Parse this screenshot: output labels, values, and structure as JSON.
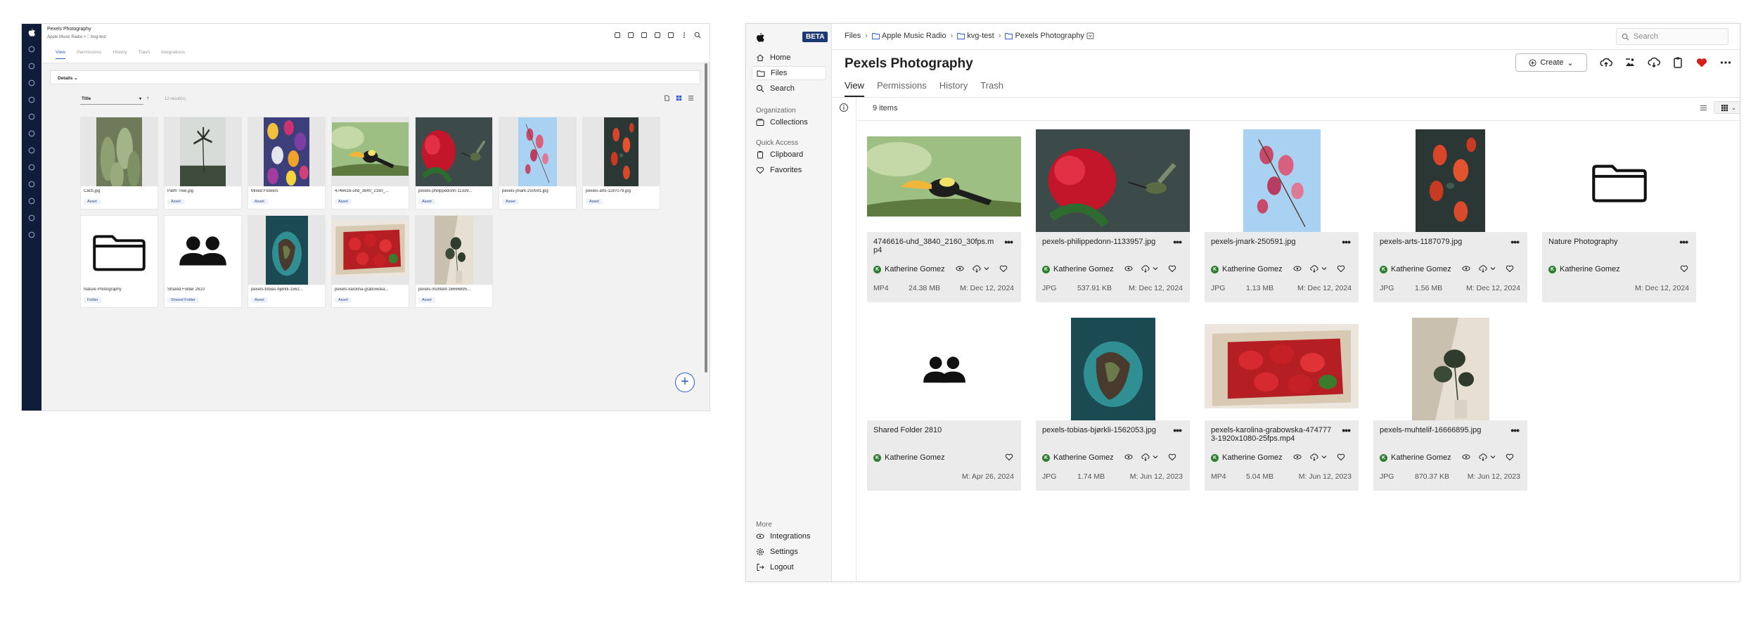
{
  "left_panel": {
    "title": "Pexels Photography",
    "breadcrumb": "Apple Music Radio > 🗀kvg-test",
    "tabs": [
      {
        "label": "View",
        "active": true
      },
      {
        "label": "Permissions",
        "active": false
      },
      {
        "label": "History",
        "active": false
      },
      {
        "label": "Trash",
        "active": false
      },
      {
        "label": "Integrations",
        "active": false
      }
    ],
    "details_label": "Details ⌄",
    "sort_label": "Title",
    "result_count": "12 result(s)",
    "items": [
      {
        "name": "Cacti.jpg",
        "tag": "Asset",
        "thumb": "cacti"
      },
      {
        "name": "Palm Tree.jpg",
        "tag": "Asset",
        "thumb": "palm"
      },
      {
        "name": "Mixed Flowers",
        "tag": "Asset",
        "thumb": "flowers"
      },
      {
        "name": "4746616-uhd_3840_2160_...",
        "tag": "Asset",
        "thumb": "toucan"
      },
      {
        "name": "pexels-philippedonn-11339...",
        "tag": "Asset",
        "thumb": "hummingbird"
      },
      {
        "name": "pexels-jmark-250591.jpg",
        "tag": "Asset",
        "thumb": "blossom"
      },
      {
        "name": "pexels-arts-1187079.jpg",
        "tag": "Asset",
        "thumb": "roses"
      },
      {
        "name": "Nature Photography",
        "tag": "Folder",
        "thumb": "folder"
      },
      {
        "name": "Shared Folder 2810",
        "tag": "Shared Folder",
        "thumb": "shared"
      },
      {
        "name": "pexels-tobias-bjørkli-1562...",
        "tag": "Asset",
        "thumb": "island"
      },
      {
        "name": "pexels-karolina-grabowska...",
        "tag": "Asset",
        "thumb": "strawberries"
      },
      {
        "name": "pexels-muhtelif-16666895...",
        "tag": "Asset",
        "thumb": "plant"
      }
    ],
    "fab_label": "+"
  },
  "right_panel": {
    "beta_badge": "BETA",
    "nav": [
      {
        "label": "Home",
        "icon": "home-icon"
      },
      {
        "label": "Files",
        "icon": "folder-icon",
        "active": true
      },
      {
        "label": "Search",
        "icon": "search-icon"
      }
    ],
    "org_section": "Organization",
    "org_items": [
      {
        "label": "Collections",
        "icon": "collections-icon"
      }
    ],
    "quick_section": "Quick Access",
    "quick_items": [
      {
        "label": "Clipboard",
        "icon": "clipboard-icon"
      },
      {
        "label": "Favorites",
        "icon": "heart-icon"
      }
    ],
    "more_section": "More",
    "more_items": [
      {
        "label": "Integrations",
        "icon": "integrations-icon"
      },
      {
        "label": "Settings",
        "icon": "gear-icon"
      },
      {
        "label": "Logout",
        "icon": "logout-icon"
      }
    ],
    "breadcrumb": [
      "Files",
      "Apple Music Radio",
      "kvg-test",
      "Pexels Photography"
    ],
    "search_placeholder": "Search",
    "title": "Pexels Photography",
    "create_label": "Create",
    "tabs": [
      {
        "label": "View",
        "active": true
      },
      {
        "label": "Permissions",
        "active": false
      },
      {
        "label": "History",
        "active": false
      },
      {
        "label": "Trash",
        "active": false
      }
    ],
    "item_count": "9 items",
    "cards": [
      {
        "name": "4746616-uhd_3840_2160_30fps.mp4",
        "owner": "Katherine Gomez",
        "type": "MP4",
        "size": "24.38 MB",
        "modified": "M: Dec 12, 2024",
        "thumb": "toucan",
        "kind": "asset"
      },
      {
        "name": "pexels-philippedonn-1133957.jpg",
        "owner": "Katherine Gomez",
        "type": "JPG",
        "size": "537.91 KB",
        "modified": "M: Dec 12, 2024",
        "thumb": "hummingbird",
        "kind": "asset"
      },
      {
        "name": "pexels-jmark-250591.jpg",
        "owner": "Katherine Gomez",
        "type": "JPG",
        "size": "1.13 MB",
        "modified": "M: Dec 12, 2024",
        "thumb": "blossom",
        "kind": "asset"
      },
      {
        "name": "pexels-arts-1187079.jpg",
        "owner": "Katherine Gomez",
        "type": "JPG",
        "size": "1.56 MB",
        "modified": "M: Dec 12, 2024",
        "thumb": "roses",
        "kind": "asset"
      },
      {
        "name": "Nature Photography",
        "owner": "Katherine Gomez",
        "type": "",
        "size": "",
        "modified": "M: Dec 12, 2024",
        "thumb": "folder",
        "kind": "folder"
      },
      {
        "name": "Shared Folder 2810",
        "owner": "Katherine Gomez",
        "type": "",
        "size": "",
        "modified": "M: Apr 26, 2024",
        "thumb": "shared",
        "kind": "shared"
      },
      {
        "name": "pexels-tobias-bjørkli-1562053.jpg",
        "owner": "Katherine Gomez",
        "type": "JPG",
        "size": "1.74 MB",
        "modified": "M: Jun 12, 2023",
        "thumb": "island",
        "kind": "asset"
      },
      {
        "name": "pexels-karolina-grabowska-4747773-1920x1080-25fps.mp4",
        "owner": "Katherine Gomez",
        "type": "MP4",
        "size": "5.04 MB",
        "modified": "M: Jun 12, 2023",
        "thumb": "strawberries",
        "kind": "asset"
      },
      {
        "name": "pexels-muhtelif-16666895.jpg",
        "owner": "Katherine Gomez",
        "type": "JPG",
        "size": "870.37 KB",
        "modified": "M: Jun 12, 2023",
        "thumb": "plant",
        "kind": "asset"
      }
    ],
    "colors": {
      "brand": "#1b3a73",
      "accent": "#2a5bd7",
      "favorite": "#d81b1b",
      "owner_avatar": "#2e7d32"
    }
  }
}
